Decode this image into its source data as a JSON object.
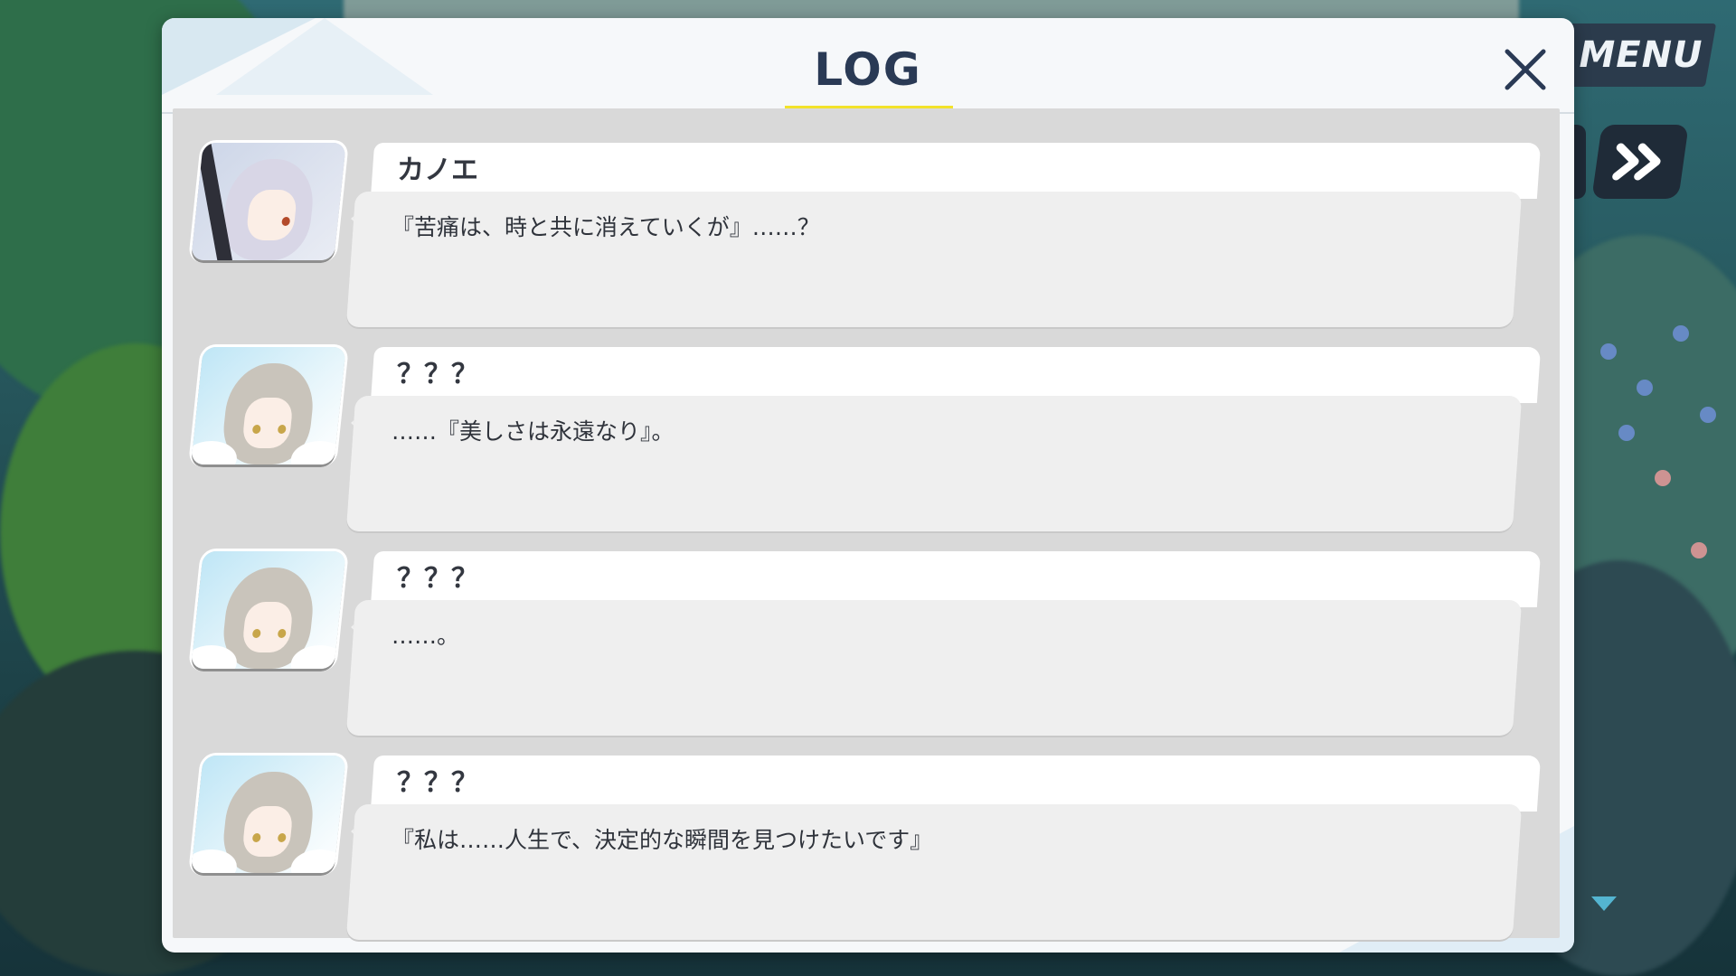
{
  "panel": {
    "title": "LOG",
    "close_icon": "close-icon"
  },
  "hud": {
    "menu_label": "MENU",
    "fast_forward_icon": "fast-forward-icon",
    "scroll_down_icon": "triangle-down-icon"
  },
  "entries": [
    {
      "speaker": "カノエ",
      "text": "『苦痛は、時と共に消えていくが』……？",
      "portrait": "kanoe-portrait"
    },
    {
      "speaker": "？？？",
      "text": "……『美しさは永遠なり』。",
      "portrait": "unknown-girl-portrait"
    },
    {
      "speaker": "？？？",
      "text": "……。",
      "portrait": "unknown-girl-portrait"
    },
    {
      "speaker": "？？？",
      "text": "『私は……人生で、決定的な瞬間を見つけたいです』",
      "portrait": "unknown-girl-portrait"
    }
  ],
  "colors": {
    "title_underline": "#f2e22a",
    "title_text": "#2a3a55",
    "menu_bg": "#2b3b4c",
    "scroll_arrow": "#54b5d1"
  }
}
